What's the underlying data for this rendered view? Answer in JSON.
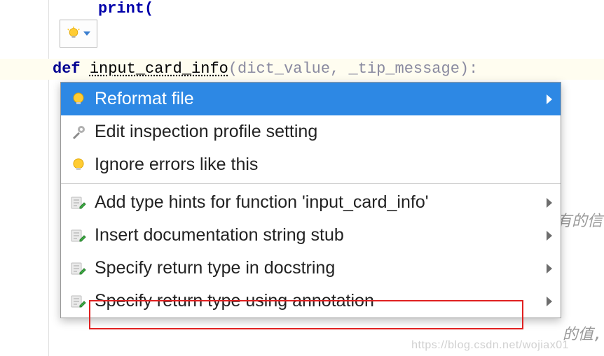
{
  "code": {
    "top_fragment": "print(",
    "def_keyword": "def",
    "func_name": "input_card_info",
    "params": "(dict_value, _tip_message):"
  },
  "hint_button": {
    "icon": "lightbulb-icon"
  },
  "menu": {
    "section1": [
      {
        "icon": "lightbulb-icon",
        "label": "Reformat file",
        "submenu": true,
        "selected": true
      },
      {
        "icon": "wrench-gear-icon",
        "label": "Edit inspection profile setting",
        "submenu": false,
        "selected": false
      },
      {
        "icon": "lightbulb-icon",
        "label": "Ignore errors like this",
        "submenu": false,
        "selected": false
      }
    ],
    "section2": [
      {
        "icon": "pencil-page-icon",
        "label": "Add type hints for function 'input_card_info'",
        "submenu": true,
        "selected": false
      },
      {
        "icon": "pencil-page-icon",
        "label": "Insert documentation string stub",
        "submenu": true,
        "selected": false,
        "highlighted": true
      },
      {
        "icon": "pencil-page-icon",
        "label": "Specify return type in docstring",
        "submenu": true,
        "selected": false
      },
      {
        "icon": "pencil-page-icon",
        "label": "Specify return type using annotation",
        "submenu": true,
        "selected": false
      }
    ]
  },
  "background_hints": {
    "right1": "有的信",
    "right2": "的值,"
  },
  "watermark": "https://blog.csdn.net/wojiax01"
}
